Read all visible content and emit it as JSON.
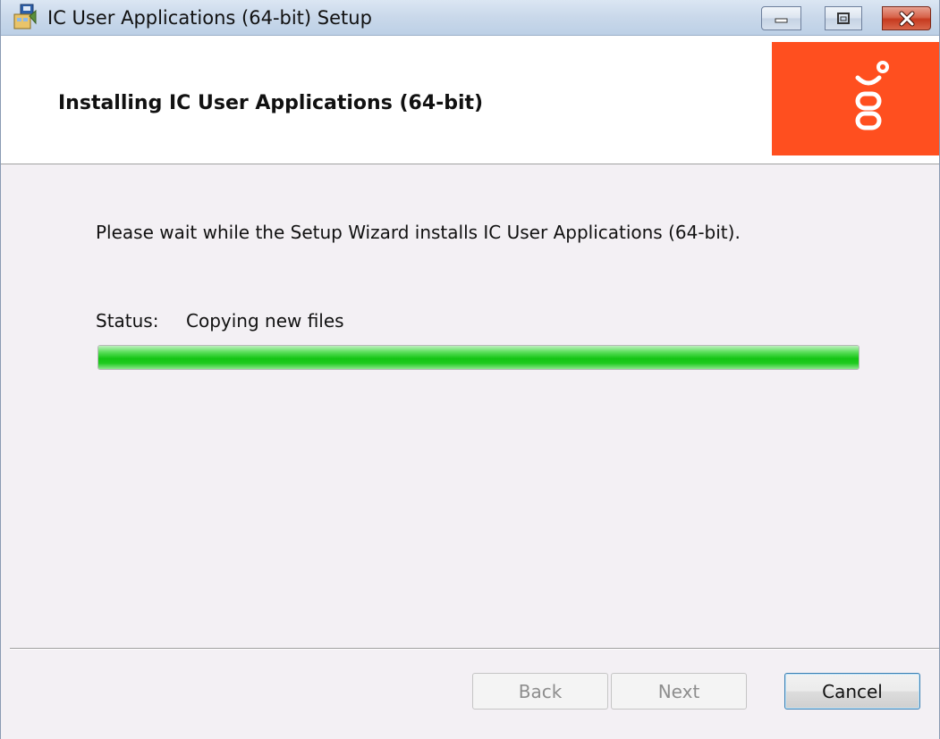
{
  "window": {
    "title": "IC User Applications (64-bit) Setup",
    "controls": {
      "minimize": "minimize-icon",
      "maximize": "maximize-icon",
      "close": "close-icon"
    }
  },
  "header": {
    "title": "Installing IC User Applications (64-bit)",
    "logo_color": "#ff4f1f"
  },
  "body": {
    "message": "Please wait while the Setup Wizard installs IC User Applications (64-bit).",
    "status_label": "Status:",
    "status_value": "Copying new files",
    "progress": 1.0,
    "progress_color": "#14c414"
  },
  "buttons": {
    "back": "Back",
    "next": "Next",
    "cancel": "Cancel"
  }
}
